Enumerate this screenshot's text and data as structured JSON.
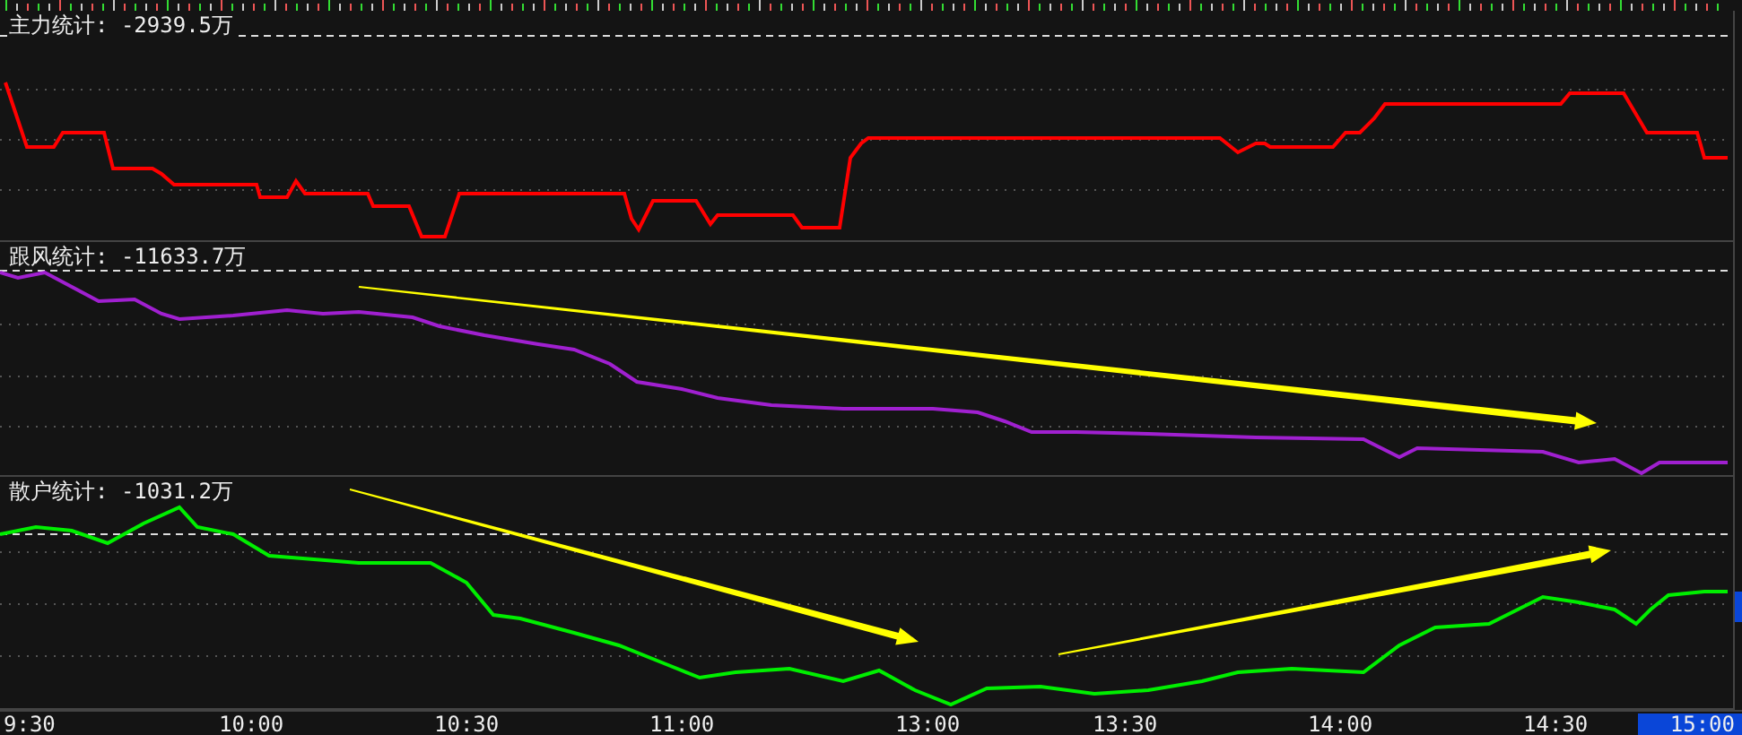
{
  "panels": [
    {
      "title": "主力统计: -2939.5万",
      "kind": "red"
    },
    {
      "title": "跟风统计: -11633.7万",
      "kind": "purple"
    },
    {
      "title": "散户统计: -1031.2万",
      "kind": "green"
    }
  ],
  "x_axis": [
    {
      "label": "9:30",
      "selected": false
    },
    {
      "label": "10:00",
      "selected": false
    },
    {
      "label": "10:30",
      "selected": false
    },
    {
      "label": "11:00",
      "selected": false
    },
    {
      "label": "13:00",
      "selected": false
    },
    {
      "label": "13:30",
      "selected": false
    },
    {
      "label": "14:00",
      "selected": false
    },
    {
      "label": "14:30",
      "selected": false
    },
    {
      "label": "15:00",
      "selected": true
    }
  ]
}
